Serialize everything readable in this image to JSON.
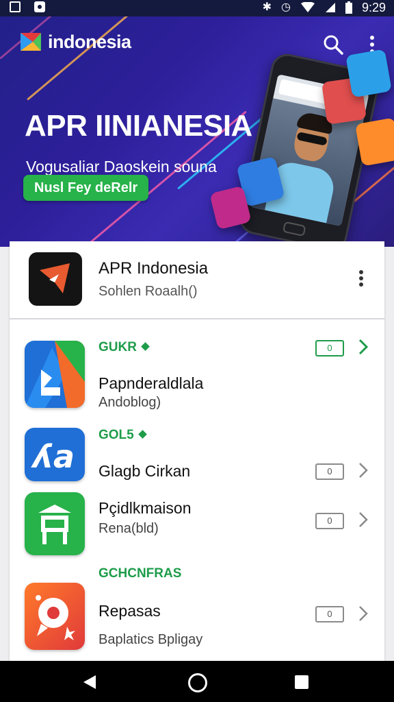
{
  "status_bar": {
    "time": "9:29"
  },
  "hero": {
    "brand": "indonesia",
    "title": "APR IINIANESIA",
    "subtitle": "Vogusaliar Daoskein souna",
    "cta_label": "Nusl Fey deRelr"
  },
  "featured_app": {
    "name": "APR Indonesia",
    "subtitle": "Sohlen Roaalh()"
  },
  "apps": [
    {
      "section_label": "GUKR",
      "name": "Papnderaldlala",
      "subtitle": "Andoblog)",
      "count": "0",
      "active": true
    },
    {
      "section_label": "GOL5",
      "name": "Glagb Cirkan",
      "subtitle": "",
      "count": "0",
      "active": false
    },
    {
      "section_label": "",
      "name": "Pçidlkmaison",
      "subtitle": "Rena(bld)",
      "count": "0",
      "active": false
    },
    {
      "section_label": "GCHCNFRAS",
      "name": "Repasas",
      "subtitle": "Baplatics Bpligay",
      "count": "0",
      "active": false
    }
  ],
  "colors": {
    "hero_bg": "#2d1f99",
    "accent_green": "#1e9c4a",
    "cta_green": "#27b24a"
  },
  "icons": {
    "status_left": [
      "window-icon",
      "photo-icon"
    ],
    "status_right": [
      "bluetooth-icon",
      "alarm-icon",
      "wifi-icon",
      "signal-icon",
      "battery-icon"
    ],
    "toolbar": [
      "search-icon",
      "more-vert-icon"
    ],
    "nav": [
      "back-icon",
      "home-icon",
      "recents-icon"
    ]
  }
}
